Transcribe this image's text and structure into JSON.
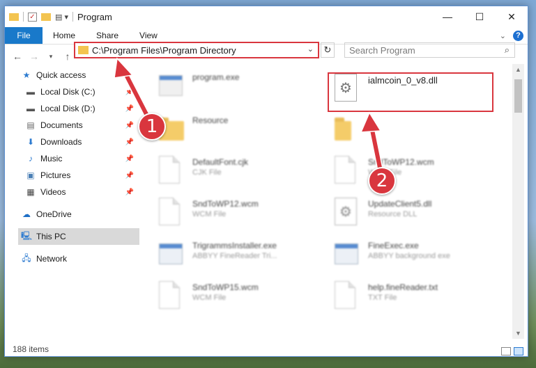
{
  "window": {
    "title": "Program"
  },
  "ribbon": {
    "tabs": [
      "File",
      "Home",
      "Share",
      "View"
    ],
    "help": "?"
  },
  "address": {
    "path": "C:\\Program Files\\Program Directory"
  },
  "search": {
    "placeholder": "Search Program"
  },
  "sidebar": {
    "items": [
      {
        "label": "Quick access",
        "icon": "star-icon",
        "pinned": false
      },
      {
        "label": "Local Disk (C:)",
        "icon": "drive-icon",
        "pinned": true
      },
      {
        "label": "Local Disk (D:)",
        "icon": "drive-icon",
        "pinned": true
      },
      {
        "label": "Documents",
        "icon": "documents-icon",
        "pinned": true
      },
      {
        "label": "Downloads",
        "icon": "download-icon",
        "pinned": true
      },
      {
        "label": "Music",
        "icon": "music-icon",
        "pinned": true
      },
      {
        "label": "Pictures",
        "icon": "pictures-icon",
        "pinned": true
      },
      {
        "label": "Videos",
        "icon": "videos-icon",
        "pinned": true
      },
      {
        "label": "OneDrive",
        "icon": "cloud-icon",
        "pinned": false
      },
      {
        "label": "This PC",
        "icon": "computer-icon",
        "pinned": false
      },
      {
        "label": "Network",
        "icon": "network-icon",
        "pinned": false
      }
    ]
  },
  "files": [
    {
      "name": "program.exe",
      "type": "",
      "icon": "gear-exe-icon"
    },
    {
      "name": "ialmcoin_0_v8.dll",
      "type": "",
      "icon": "dll-gear-icon"
    },
    {
      "name": "Resource",
      "type": "",
      "icon": "folder-icon"
    },
    {
      "name": "",
      "type": "",
      "icon": "folder-icon"
    },
    {
      "name": "DefaultFont.cjk",
      "type": "CJK File",
      "icon": "document-icon"
    },
    {
      "name": "SndToWP12.wcm",
      "type": "WCM File",
      "icon": "document-icon"
    },
    {
      "name": "SndToWP12.wcm",
      "type": "WCM File",
      "icon": "document-icon"
    },
    {
      "name": "UpdateClient5.dll",
      "type": "Resource DLL",
      "icon": "dll-gear-icon"
    },
    {
      "name": "TrigrammsInstaller.exe",
      "type": "ABBYY FineReader Tri...",
      "icon": "app-window-icon"
    },
    {
      "name": "FineExec.exe",
      "type": "ABBYY background exe",
      "icon": "app-window-icon"
    },
    {
      "name": "SndToWP15.wcm",
      "type": "WCM File",
      "icon": "document-icon"
    },
    {
      "name": "help.fineReader.txt",
      "type": "TXT File",
      "icon": "document-icon"
    }
  ],
  "annotations": {
    "step1": "1",
    "step2": "2",
    "color": "#d9363e"
  },
  "status": {
    "items": "188 items"
  }
}
